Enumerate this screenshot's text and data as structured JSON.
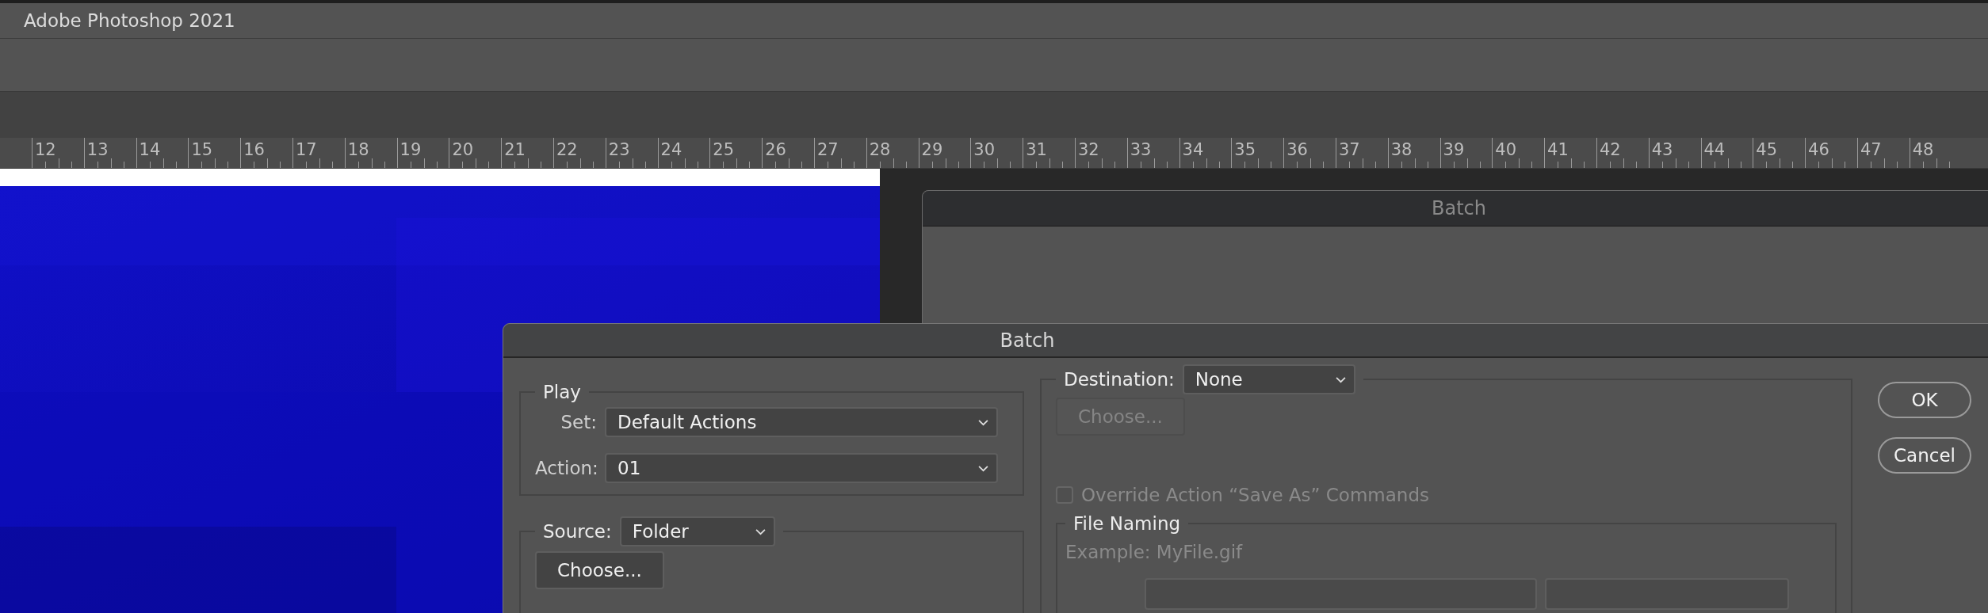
{
  "app": {
    "title": "Adobe Photoshop 2021"
  },
  "ruler": {
    "labels": [
      "12",
      "13",
      "14",
      "15",
      "16",
      "17",
      "18",
      "19",
      "20",
      "21",
      "22",
      "23",
      "24",
      "25",
      "26",
      "27",
      "28",
      "29",
      "30",
      "31",
      "32",
      "33",
      "34",
      "35",
      "36",
      "37",
      "38",
      "39",
      "40",
      "41",
      "42",
      "43",
      "44",
      "45",
      "46",
      "47",
      "48"
    ]
  },
  "background_dialog": {
    "title": "Batch"
  },
  "dialog": {
    "title": "Batch",
    "play": {
      "legend": "Play",
      "set": {
        "label": "Set:",
        "value": "Default Actions"
      },
      "action": {
        "label": "Action:",
        "value": "01"
      }
    },
    "source": {
      "label": "Source:",
      "value": "Folder",
      "choose_button": "Choose..."
    },
    "destination": {
      "label": "Destination:",
      "value": "None",
      "choose_button": {
        "label": "Choose...",
        "disabled": true
      },
      "override": {
        "label": "Override Action “Save As” Commands",
        "checked": false,
        "disabled": true
      },
      "file_naming": {
        "legend": "File Naming",
        "example": "Example: MyFile.gif"
      }
    },
    "buttons": [
      "OK",
      "Cancel"
    ]
  }
}
